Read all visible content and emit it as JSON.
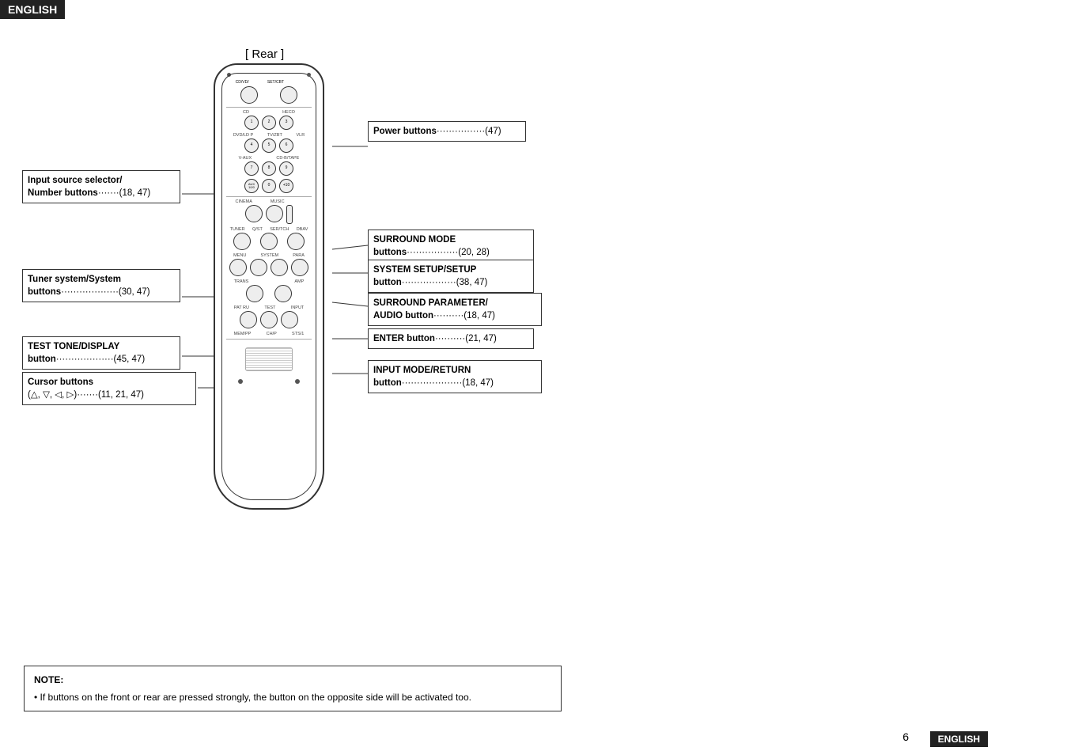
{
  "header": {
    "label": "ENGLISH"
  },
  "rear_label": "[ Rear ]",
  "annotations": {
    "power_buttons": {
      "title": "Power buttons",
      "ref": "················(47)"
    },
    "input_source": {
      "line1": "Input source selector/",
      "line2": "Number buttons",
      "ref": "·······(18, 47)"
    },
    "tuner": {
      "line1": "Tuner system/System",
      "line2": "buttons",
      "ref": "···················(30, 47)"
    },
    "test_tone": {
      "line1": "TEST TONE/DISPLAY",
      "line2": "button",
      "ref": "···················(45, 47)"
    },
    "cursor": {
      "line1": "Cursor buttons",
      "line2": "(△, ▽, ◁, ▷)",
      "ref": "·······(11, 21, 47)"
    },
    "surround_mode": {
      "line1": "SURROUND MODE",
      "line2": "buttons",
      "ref": "·················(20, 28)"
    },
    "system_setup": {
      "line1": "SYSTEM SETUP/SETUP",
      "line2": "button",
      "ref": "··················(38, 47)"
    },
    "surround_param": {
      "line1": "SURROUND PARAMETER/",
      "line2": "AUDIO button",
      "ref": "··········(18, 47)"
    },
    "enter_button": {
      "line1": "ENTER button",
      "ref": "··········(21, 47)"
    },
    "input_mode": {
      "line1": "INPUT MODE/RETURN",
      "line2": "button",
      "ref": "····················(18, 47)"
    }
  },
  "note": {
    "title": "NOTE:",
    "text": "• If buttons on the front or rear are pressed strongly, the button on the opposite side will be activated too."
  },
  "page": {
    "number": "6",
    "label": "ENGLISH"
  }
}
